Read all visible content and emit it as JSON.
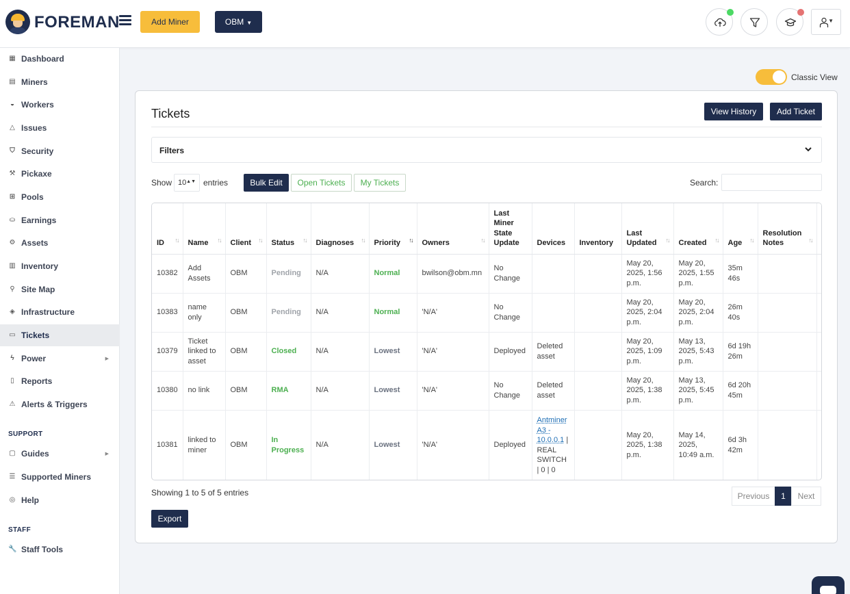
{
  "app": {
    "brand": "FOREMAN"
  },
  "topbar": {
    "add_miner": "Add Miner",
    "org": "OBM",
    "upload_status_color": "#4cd964",
    "learn_status_color": "#e57373"
  },
  "sidebar": {
    "items": [
      {
        "label": "Dashboard",
        "icon": "grid-icon"
      },
      {
        "label": "Miners",
        "icon": "server-icon"
      },
      {
        "label": "Workers",
        "icon": "helmet-icon"
      },
      {
        "label": "Issues",
        "icon": "warning-icon"
      },
      {
        "label": "Security",
        "icon": "shield-icon"
      },
      {
        "label": "Pickaxe",
        "icon": "pickaxe-icon"
      },
      {
        "label": "Pools",
        "icon": "pools-icon"
      },
      {
        "label": "Earnings",
        "icon": "earnings-icon"
      },
      {
        "label": "Assets",
        "icon": "assets-icon"
      },
      {
        "label": "Inventory",
        "icon": "inventory-icon"
      },
      {
        "label": "Site Map",
        "icon": "sitemap-icon"
      },
      {
        "label": "Infrastructure",
        "icon": "layers-icon"
      },
      {
        "label": "Tickets",
        "icon": "ticket-icon"
      },
      {
        "label": "Power",
        "icon": "bolt-icon"
      },
      {
        "label": "Reports",
        "icon": "report-icon"
      },
      {
        "label": "Alerts & Triggers",
        "icon": "alert-icon"
      }
    ],
    "support_title": "SUPPORT",
    "support_items": [
      {
        "label": "Guides",
        "icon": "book-icon"
      },
      {
        "label": "Supported Miners",
        "icon": "list-icon"
      },
      {
        "label": "Help",
        "icon": "lifebuoy-icon"
      }
    ],
    "staff_title": "STAFF",
    "staff_items": [
      {
        "label": "Staff Tools",
        "icon": "wrench-icon"
      }
    ]
  },
  "view_toggle": {
    "label": "Classic View",
    "on": true
  },
  "tickets": {
    "title": "Tickets",
    "view_history": "View History",
    "add_ticket": "Add Ticket",
    "filters_label": "Filters",
    "show_label": "Show",
    "entries_label": "entries",
    "page_size": "10",
    "bulk_edit": "Bulk Edit",
    "open_tickets": "Open Tickets",
    "my_tickets": "My Tickets",
    "search_label": "Search:",
    "search_value": "",
    "columns": [
      "ID",
      "Name",
      "Client",
      "Status",
      "Diagnoses",
      "Priority",
      "Owners",
      "Last Miner State Update",
      "Devices",
      "Inventory",
      "Last Updated",
      "Created",
      "Age",
      "Resolution Notes"
    ],
    "rows": [
      {
        "id": "10382",
        "name": "Add Assets",
        "client": "OBM",
        "status": "Pending",
        "diagnoses": "N/A",
        "priority": "Normal",
        "owners": "bwilson@obm.mn",
        "state": "No Change",
        "devices": "",
        "inventory": "",
        "updated": "May 20, 2025, 1:56 p.m.",
        "created": "May 20, 2025, 1:55 p.m.",
        "age": "35m 46s",
        "notes": ""
      },
      {
        "id": "10383",
        "name": "name only",
        "client": "OBM",
        "status": "Pending",
        "diagnoses": "N/A",
        "priority": "Normal",
        "owners": "'N/A'",
        "state": "No Change",
        "devices": "",
        "inventory": "",
        "updated": "May 20, 2025, 2:04 p.m.",
        "created": "May 20, 2025, 2:04 p.m.",
        "age": "26m 40s",
        "notes": ""
      },
      {
        "id": "10379",
        "name": "Ticket linked to asset",
        "client": "OBM",
        "status": "Closed",
        "diagnoses": "N/A",
        "priority": "Lowest",
        "owners": "'N/A'",
        "state": "Deployed",
        "devices": "Deleted asset",
        "inventory": "",
        "updated": "May 20, 2025, 1:09 p.m.",
        "created": "May 13, 2025, 5:43 p.m.",
        "age": "6d 19h 26m",
        "notes": ""
      },
      {
        "id": "10380",
        "name": "no link",
        "client": "OBM",
        "status": "RMA",
        "diagnoses": "N/A",
        "priority": "Lowest",
        "owners": "'N/A'",
        "state": "No Change",
        "devices": "Deleted asset",
        "inventory": "",
        "updated": "May 20, 2025, 1:38 p.m.",
        "created": "May 13, 2025, 5:45 p.m.",
        "age": "6d 20h 45m",
        "notes": ""
      },
      {
        "id": "10381",
        "name": "linked to miner",
        "client": "OBM",
        "status": "In Progress",
        "diagnoses": "N/A",
        "priority": "Lowest",
        "owners": "'N/A'",
        "state": "Deployed",
        "devices_link": "Antminer A3 - 10.0.0.1",
        "devices": " | REAL SWITCH | 0 | 0",
        "inventory": "",
        "updated": "May 20, 2025, 1:38 p.m.",
        "created": "May 14, 2025, 10:49 a.m.",
        "age": "6d 3h 42m",
        "notes": ""
      }
    ],
    "showing": "Showing 1 to 5 of 5 entries",
    "pager": {
      "previous": "Previous",
      "current": "1",
      "next": "Next"
    },
    "export": "Export"
  }
}
